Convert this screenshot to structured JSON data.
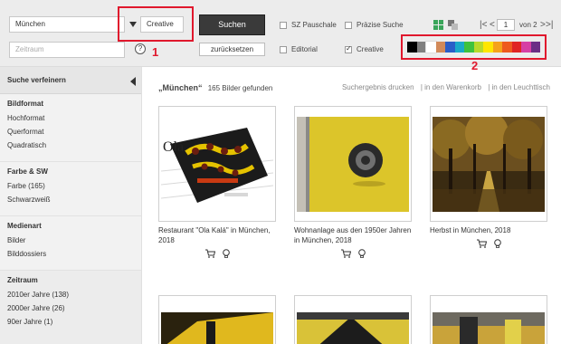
{
  "toolbar": {
    "search_value": "München",
    "date_placeholder": "Zeitraum",
    "collection_value": "Creative",
    "search_button": "Suchen",
    "reset_button": "zurücksetzen",
    "help_symbol": "?",
    "checkboxes": [
      {
        "label": "SZ Pauschale",
        "checked": false
      },
      {
        "label": "Präzise Suche",
        "checked": false
      },
      {
        "label": "Editorial",
        "checked": false
      },
      {
        "label": "Creative",
        "checked": true
      }
    ],
    "pager": {
      "current": "1",
      "total_label": "von 2"
    },
    "annotations": [
      "1",
      "2"
    ],
    "color_filter": [
      "#000000",
      "#808080",
      "#ffffff",
      "#d28a5a",
      "#2a5ec8",
      "#1aa9c8",
      "#3ec23e",
      "#b7d92b",
      "#ffe600",
      "#f5a21b",
      "#ee5a1f",
      "#e02424",
      "#d63fa4",
      "#6b2f86"
    ],
    "accent_color": "#e0182d"
  },
  "sidebar": {
    "header": "Suche verfeinern",
    "sections": [
      {
        "title": "Bildformat",
        "items": [
          "Hochformat",
          "Querformat",
          "Quadratisch"
        ]
      },
      {
        "title": "Farbe & SW",
        "items": [
          "Farbe (165)",
          "Schwarzweiß"
        ]
      },
      {
        "title": "Medienart",
        "items": [
          "Bilder",
          "Bilddossiers"
        ]
      },
      {
        "title": "Zeitraum",
        "items": [
          "2010er Jahre (138)",
          "2000er Jahre (26)",
          "90er Jahre (1)"
        ]
      }
    ]
  },
  "results": {
    "query": "„München“",
    "count_text": "165 Bilder gefunden",
    "links": [
      "Suchergebnis drucken",
      "| in den Warenkorb",
      "| in den Leuchttisch"
    ],
    "cards": [
      {
        "caption": "Restaurant \"Ola Kalá\" in München, 2018",
        "thumb_text": "Ola"
      },
      {
        "caption": "Wohnanlage aus den 1950er Jahren in München, 2018"
      },
      {
        "caption": "Herbst in München, 2018"
      }
    ]
  }
}
